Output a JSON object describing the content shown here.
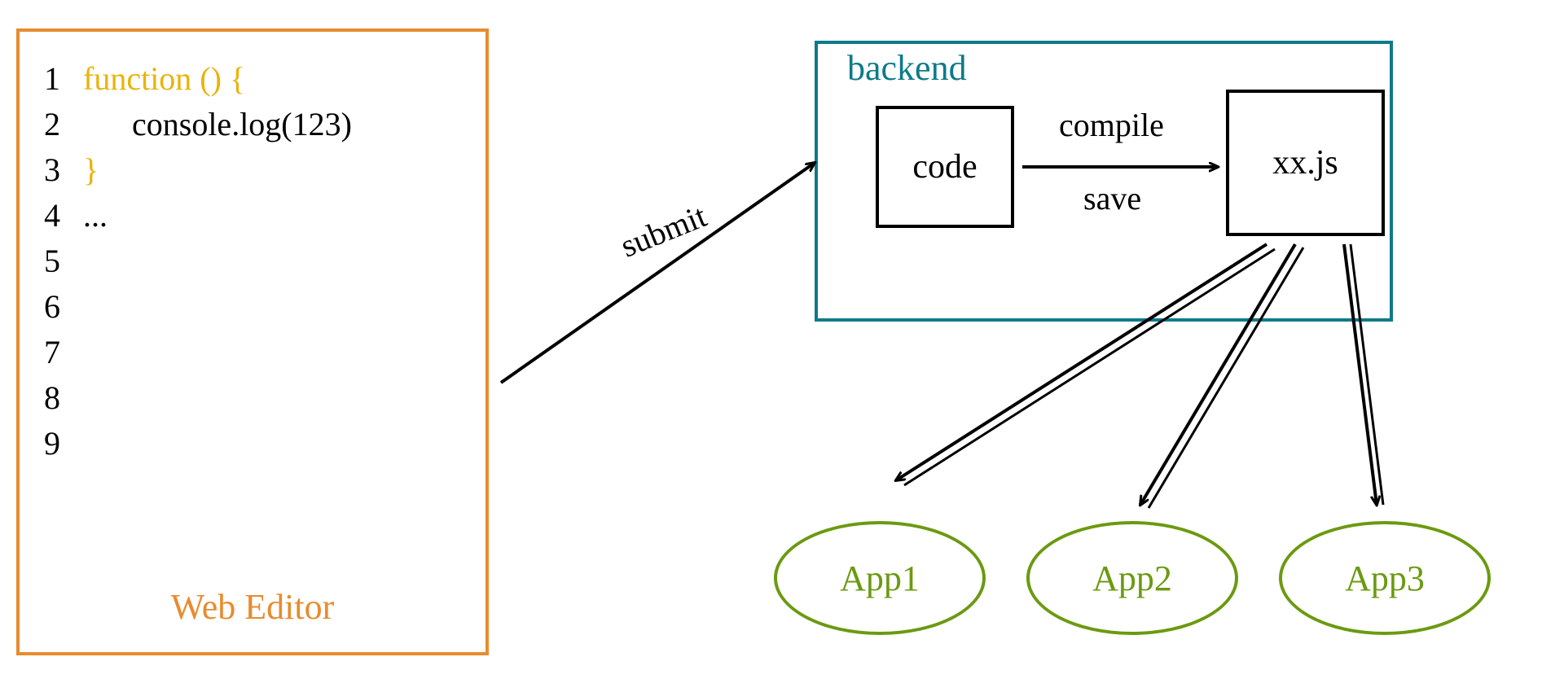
{
  "editor": {
    "title": "Web Editor",
    "lines": {
      "l1": "function () {",
      "l2": "console.log(123)",
      "l3": "}",
      "l4": "...",
      "n1": "1",
      "n2": "2",
      "n3": "3",
      "n4": "4",
      "n5": "5",
      "n6": "6",
      "n7": "7",
      "n8": "8",
      "n9": "9"
    }
  },
  "backend": {
    "title": "backend",
    "code_node": "code",
    "output_node": "xx.js",
    "compile_label": "compile",
    "save_label": "save"
  },
  "arrows": {
    "submit_label": "submit"
  },
  "apps": {
    "a1": "App1",
    "a2": "App2",
    "a3": "App3"
  },
  "colors": {
    "editor_border": "#e88b2e",
    "backend_border": "#0d7a8a",
    "keyword": "#eab308",
    "app": "#6b9a10",
    "ink": "#000000"
  }
}
